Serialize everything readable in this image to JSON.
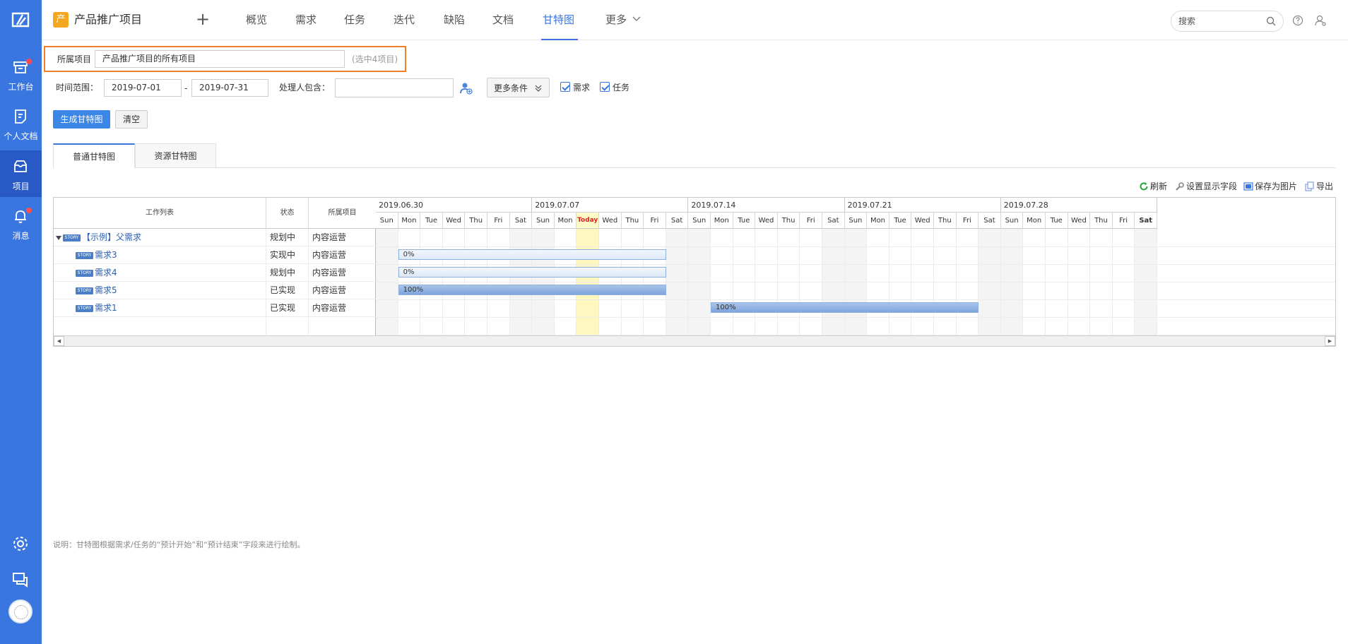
{
  "rail": {
    "items": [
      {
        "label": "工作台"
      },
      {
        "label": "个人文档"
      },
      {
        "label": "项目"
      },
      {
        "label": "消息"
      }
    ]
  },
  "header": {
    "project_icon_char": "产",
    "project_name": "产品推广项目",
    "plus": "+",
    "tabs": [
      {
        "label": "概览"
      },
      {
        "label": "需求"
      },
      {
        "label": "任务"
      },
      {
        "label": "迭代"
      },
      {
        "label": "缺陷"
      },
      {
        "label": "文档"
      },
      {
        "label": "甘特图"
      },
      {
        "label": "更多"
      }
    ],
    "search_placeholder": "搜索"
  },
  "filters": {
    "project_label": "所属项目",
    "project_value": "产品推广项目的所有项目",
    "project_hint": "(选中4项目)",
    "time_label": "时间范围：",
    "date_from": "2019-07-01",
    "date_sep": "-",
    "date_to": "2019-07-31",
    "handler_label": "处理人包含：",
    "handler_value": "",
    "more_label": "更多条件",
    "cb_story": "需求",
    "cb_task": "任务",
    "generate": "生成甘特图",
    "clear": "清空"
  },
  "subtabs": [
    "普通甘特图",
    "资源甘特图"
  ],
  "toolbar": {
    "refresh": "刷新",
    "fields": "设置显示字段",
    "save_img": "保存为图片",
    "export": "导出"
  },
  "gantt": {
    "headers": {
      "work": "工作列表",
      "status": "状态",
      "project": "所属项目"
    },
    "rows": [
      {
        "tag": "STORY",
        "title": "【示例】父需求",
        "status": "规划中",
        "project": "内容运营",
        "parent": true
      },
      {
        "tag": "STORY",
        "title": "需求3",
        "status": "实现中",
        "project": "内容运营",
        "parent": false
      },
      {
        "tag": "STORY",
        "title": "需求4",
        "status": "规划中",
        "project": "内容运营",
        "parent": false
      },
      {
        "tag": "STORY",
        "title": "需求5",
        "status": "已实现",
        "project": "内容运营",
        "parent": false
      },
      {
        "tag": "STORY",
        "title": "需求1",
        "status": "已实现",
        "project": "内容运营",
        "parent": false
      }
    ],
    "weeks": [
      "2019.06.30",
      "2019.07.07",
      "2019.07.14",
      "2019.07.21",
      "2019.07.28"
    ],
    "days": [
      "Sun",
      "Mon",
      "Tue",
      "Wed",
      "Thu",
      "Fri",
      "Sat",
      "Sun",
      "Mon",
      "Today",
      "Wed",
      "Thu",
      "Fri",
      "Sat",
      "Sun",
      "Mon",
      "Tue",
      "Wed",
      "Thu",
      "Fri",
      "Sat",
      "Sun",
      "Mon",
      "Tue",
      "Wed",
      "Thu",
      "Fri",
      "Sat",
      "Sun",
      "Mon",
      "Tue",
      "Wed",
      "Thu",
      "Fri",
      "Sat"
    ],
    "bars": [
      {
        "row": 1,
        "start": "2019-07-01",
        "end": "2019-07-12",
        "progress": 0,
        "label": "0%"
      },
      {
        "row": 2,
        "start": "2019-07-01",
        "end": "2019-07-12",
        "progress": 0,
        "label": "0%"
      },
      {
        "row": 3,
        "start": "2019-07-01",
        "end": "2019-07-12",
        "progress": 100,
        "label": "100%"
      },
      {
        "row": 4,
        "start": "2019-07-15",
        "end": "2019-07-26",
        "progress": 100,
        "label": "100%"
      }
    ]
  },
  "note": "说明：甘特图根据需求/任务的“预计开始”和“预计结束”字段来进行绘制。"
}
